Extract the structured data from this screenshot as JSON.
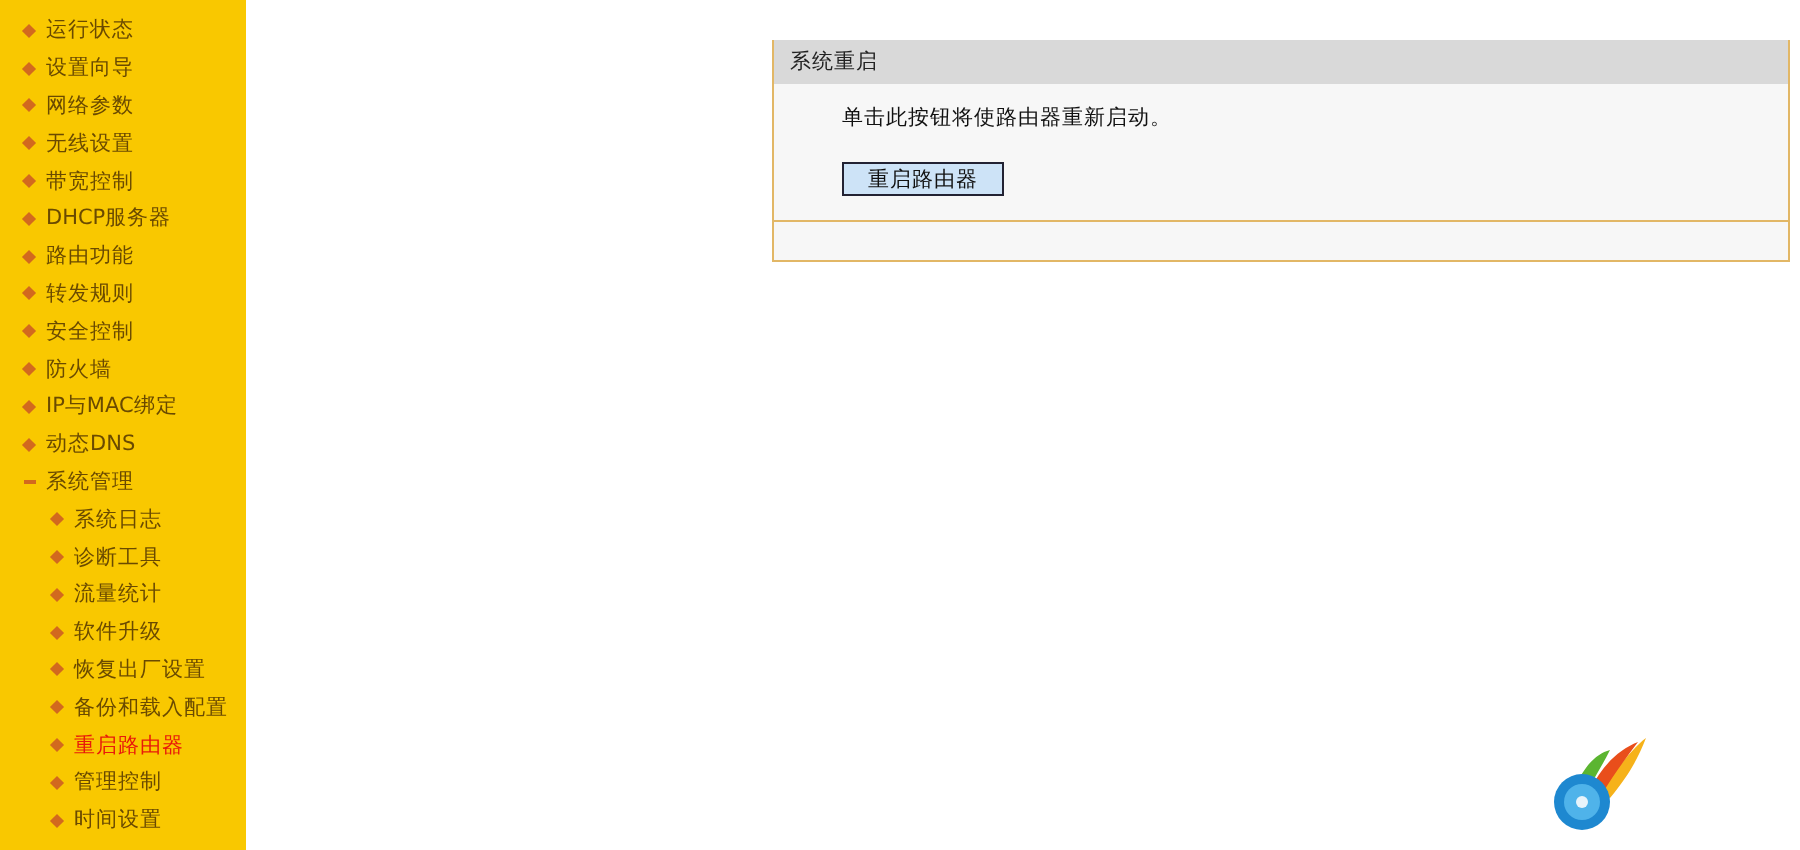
{
  "sidebar": {
    "items": [
      {
        "label": "运行状态",
        "selected": false
      },
      {
        "label": "设置向导",
        "selected": false
      },
      {
        "label": "网络参数",
        "selected": false
      },
      {
        "label": "无线设置",
        "selected": false
      },
      {
        "label": "带宽控制",
        "selected": false
      },
      {
        "label": "DHCP服务器",
        "selected": false
      },
      {
        "label": "路由功能",
        "selected": false
      },
      {
        "label": "转发规则",
        "selected": false
      },
      {
        "label": "安全控制",
        "selected": false
      },
      {
        "label": "防火墙",
        "selected": false
      },
      {
        "label": "IP与MAC绑定",
        "selected": false
      },
      {
        "label": "动态DNS",
        "selected": false
      },
      {
        "label": "系统管理",
        "selected": false,
        "expanded": true,
        "children": [
          {
            "label": "系统日志",
            "selected": false
          },
          {
            "label": "诊断工具",
            "selected": false
          },
          {
            "label": "流量统计",
            "selected": false
          },
          {
            "label": "软件升级",
            "selected": false
          },
          {
            "label": "恢复出厂设置",
            "selected": false
          },
          {
            "label": "备份和载入配置",
            "selected": false
          },
          {
            "label": "重启路由器",
            "selected": true
          },
          {
            "label": "管理控制",
            "selected": false
          },
          {
            "label": "时间设置",
            "selected": false
          }
        ]
      }
    ]
  },
  "panel": {
    "title": "系统重启",
    "message": "单击此按钮将使路由器重新启动。",
    "button": "重启路由器"
  }
}
